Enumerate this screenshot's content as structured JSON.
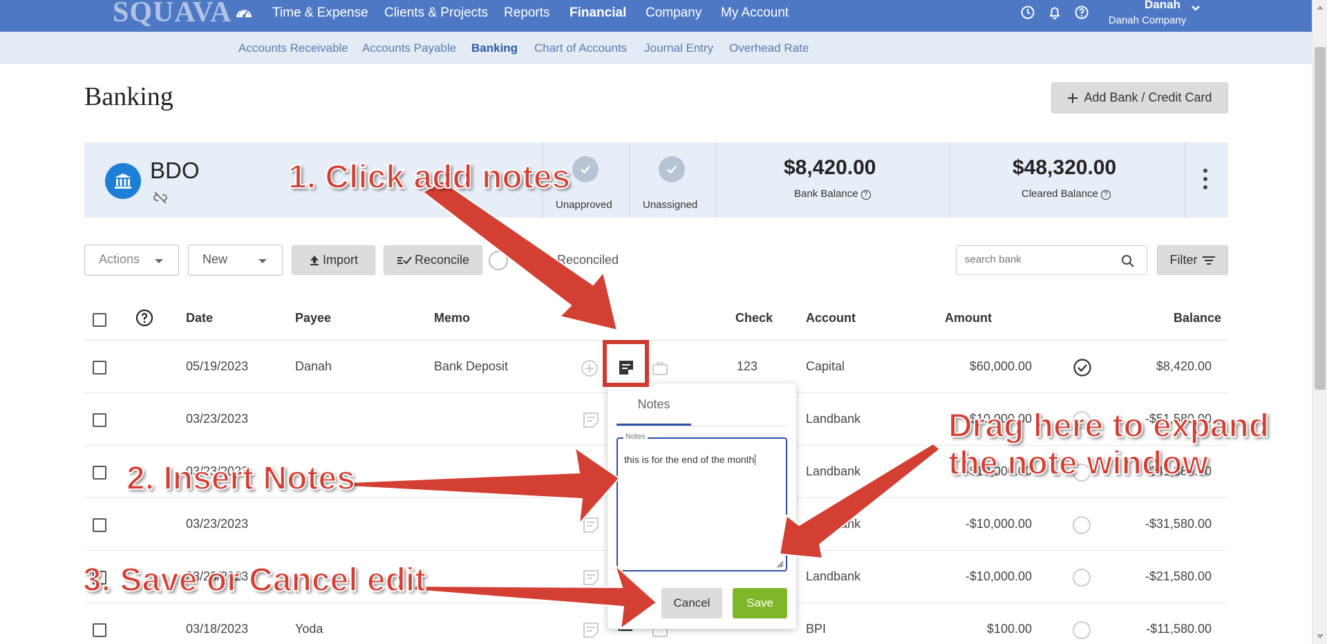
{
  "app": {
    "logo": "SQUAVA",
    "nav": [
      "Time & Expense",
      "Clients & Projects",
      "Reports",
      "Financial",
      "Company",
      "My Account"
    ],
    "active_nav": "Financial",
    "user": {
      "name": "Danah",
      "company": "Danah Company"
    }
  },
  "subnav": {
    "items": [
      "Accounts Receivable",
      "Accounts Payable",
      "Banking",
      "Chart of Accounts",
      "Journal Entry",
      "Overhead Rate"
    ],
    "active": "Banking"
  },
  "page": {
    "title": "Banking",
    "add_button": "Add Bank / Credit Card"
  },
  "account": {
    "name": "BDO",
    "unapproved_label": "Unapproved",
    "unassigned_label": "Unassigned",
    "bank_balance": "$8,420.00",
    "bank_balance_label": "Bank Balance",
    "cleared_balance": "$48,320.00",
    "cleared_balance_label": "Cleared Balance"
  },
  "toolbar": {
    "actions_label": "Actions",
    "new_label": "New",
    "import_label": "Import",
    "reconcile_label": "Reconcile",
    "hide_reconciled_label": "Hide Reconciled",
    "search_placeholder": "search bank",
    "filter_label": "Filter"
  },
  "table": {
    "headers": {
      "date": "Date",
      "payee": "Payee",
      "memo": "Memo",
      "check": "Check",
      "account": "Account",
      "amount": "Amount",
      "balance": "Balance"
    },
    "rows": [
      {
        "date": "05/19/2023",
        "payee": "Danah",
        "memo": "Bank Deposit",
        "check": "123",
        "account": "Capital",
        "amount": "$60,000.00",
        "balance": "$8,420.00"
      },
      {
        "date": "03/23/2023",
        "payee": "",
        "memo": "",
        "check": "",
        "account": "Landbank",
        "amount": "-$10,000.00",
        "balance": "-$51,580.00"
      },
      {
        "date": "03/23/2023",
        "payee": "",
        "memo": "",
        "check": "",
        "account": "Landbank",
        "amount": "-$10,000.00",
        "balance": "-$41,580.00"
      },
      {
        "date": "03/23/2023",
        "payee": "",
        "memo": "",
        "check": "",
        "account": "Landbank",
        "amount": "-$10,000.00",
        "balance": "-$31,580.00"
      },
      {
        "date": "03/23/2023",
        "payee": "",
        "memo": "",
        "check": "",
        "account": "Landbank",
        "amount": "-$10,000.00",
        "balance": "-$21,580.00"
      },
      {
        "date": "03/18/2023",
        "payee": "Yoda",
        "memo": "",
        "check": "",
        "account": "BPI",
        "amount": "$100.00",
        "balance": "-$11,580.00"
      }
    ]
  },
  "notes_popup": {
    "tab_label": "Notes",
    "field_label": "Notes",
    "value": "this is for the end of the month",
    "cancel_label": "Cancel",
    "save_label": "Save"
  },
  "annotations": {
    "step1": "1. Click add notes",
    "step2": "2. Insert Notes",
    "step3": "3. Save or Cancel edit",
    "drag_line1": "Drag here to expand",
    "drag_line2": "the note window"
  },
  "colors": {
    "nav_bg": "#4e78c4",
    "subnav_bg": "#e4ebf5",
    "save_green": "#7fb62a",
    "annotation_red": "#d43f33"
  }
}
